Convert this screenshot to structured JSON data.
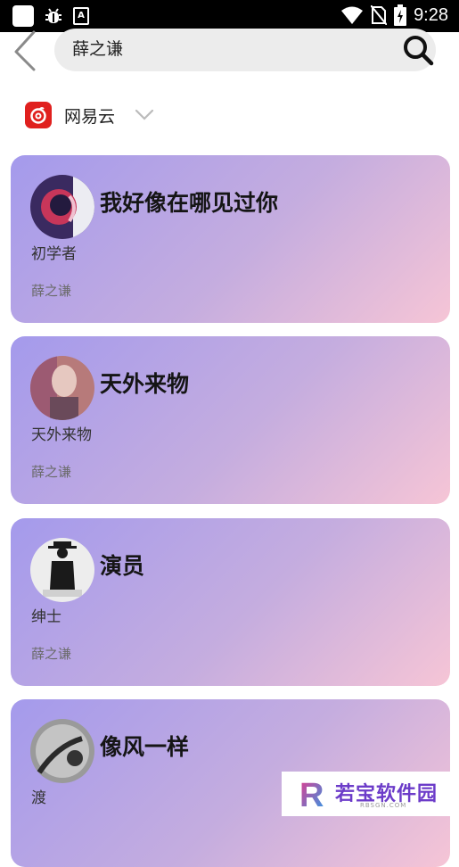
{
  "status_bar": {
    "time": "9:28",
    "icons": [
      "square-icon",
      "bug-icon",
      "a-icon",
      "wifi-icon",
      "no-sim-icon",
      "battery-charging-icon"
    ]
  },
  "header": {
    "back_icon": "chevron-left-icon",
    "search_value": "薛之谦",
    "search_icon": "search-icon"
  },
  "source": {
    "label": "网易云",
    "icon": "netease-cloud-music-icon",
    "dropdown_icon": "chevron-down-icon"
  },
  "results": [
    {
      "title": "我好像在哪见过你",
      "album": "初学者",
      "artist": "薛之谦"
    },
    {
      "title": "天外来物",
      "album": "天外来物",
      "artist": "薛之谦"
    },
    {
      "title": "演员",
      "album": "绅士",
      "artist": "薛之谦"
    },
    {
      "title": "像风一样",
      "album": "渡",
      "artist": ""
    }
  ],
  "watermark": {
    "logo_letter": "R",
    "text": "若宝软件园",
    "sub": "RBSGN.COM"
  }
}
